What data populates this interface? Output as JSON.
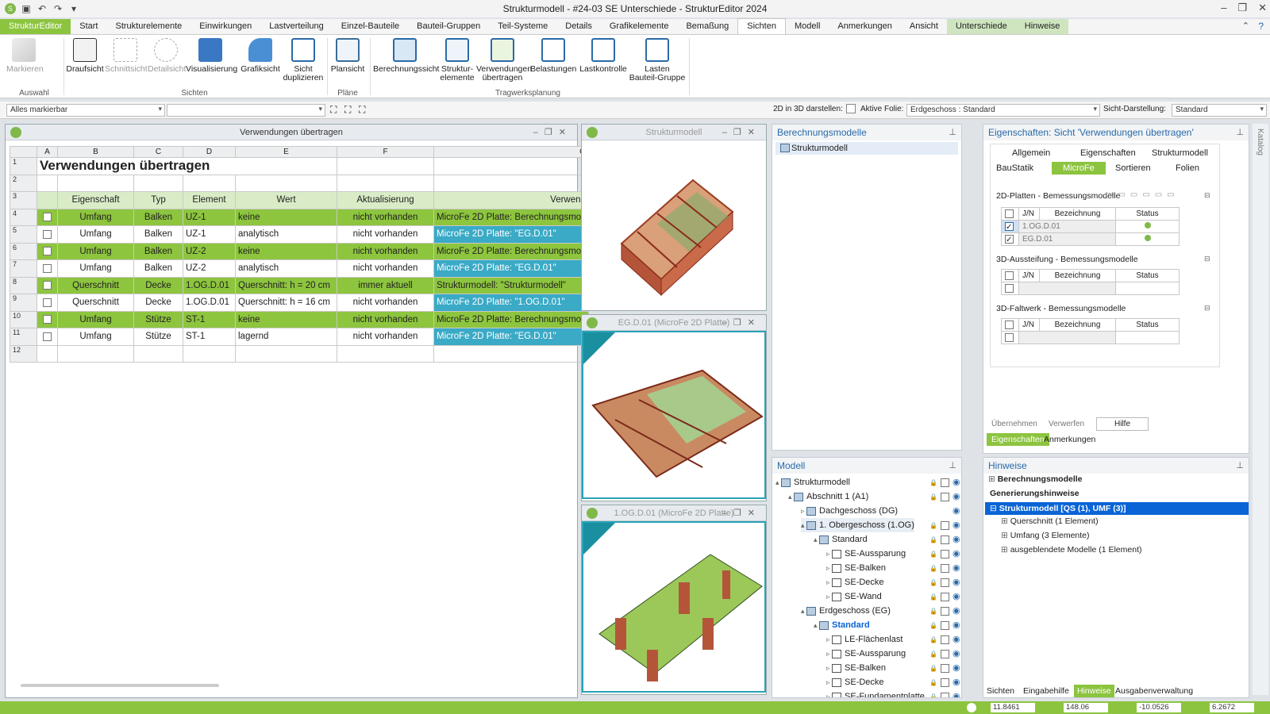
{
  "window": {
    "title": "Strukturmodell - #24-03 SE Unterschiede - StrukturEditor 2024"
  },
  "tabs": [
    "StrukturEditor",
    "Start",
    "Strukturelemente",
    "Einwirkungen",
    "Lastverteilung",
    "Einzel-Bauteile",
    "Bauteil-Gruppen",
    "Teil-Systeme",
    "Details",
    "Grafikelemente",
    "Bemaßung",
    "Sichten",
    "Modell",
    "Anmerkungen",
    "Ansicht",
    "Unterschiede",
    "Hinweise"
  ],
  "ribbon": {
    "markieren": "Markieren",
    "draufsicht": "Draufsicht",
    "schnittsicht": "Schnittsicht",
    "detailsicht": "Detailsicht",
    "visualisierung": "Visualisierung",
    "grafiksicht": "Grafiksicht",
    "sicht_dup_1": "Sicht",
    "sicht_dup_2": "duplizieren",
    "plansicht": "Plansicht",
    "berechnungssicht": "Berechnungssicht",
    "struktur_1": "Struktur-",
    "struktur_2": "elemente",
    "verw_1": "Verwendungen",
    "verw_2": "übertragen",
    "belastungen": "Belastungen",
    "lastkontrolle": "Lastkontrolle",
    "lasten_1": "Lasten",
    "lasten_2": "Bauteil-Gruppe",
    "grp_auswahl": "Auswahl",
    "grp_sichten": "Sichten",
    "grp_plaene": "Pläne",
    "grp_tragwerk": "Tragwerksplanung"
  },
  "toolbar": {
    "combo1": "Alles markierbar",
    "d2in3d": "2D in 3D darstellen:",
    "aktive_folie_label": "Aktive Folie:",
    "aktive_folie": "Erdgeschoss : Standard",
    "sicht_label": "Sicht-Darstellung:",
    "sicht_value": "Standard"
  },
  "table_panel": {
    "title": "Verwendungen übertragen",
    "columns": [
      "A",
      "B",
      "C",
      "D",
      "E",
      "F",
      "G"
    ],
    "heading": "Verwendungen übertragen",
    "headers": [
      "Eigenschaft",
      "Typ",
      "Element",
      "Wert",
      "Aktualisierung",
      "Verwend"
    ],
    "rows": [
      {
        "n": "4",
        "eig": "Umfang",
        "typ": "Balken",
        "el": "UZ-1",
        "wert": "keine",
        "akt": "nicht vorhanden",
        "verw": "MicroFe 2D Platte: Berechnungsmoc"
      },
      {
        "n": "5",
        "eig": "Umfang",
        "typ": "Balken",
        "el": "UZ-1",
        "wert": "analytisch",
        "akt": "nicht vorhanden",
        "verw": "MicroFe 2D Platte: \"EG.D.01\""
      },
      {
        "n": "6",
        "eig": "Umfang",
        "typ": "Balken",
        "el": "UZ-2",
        "wert": "keine",
        "akt": "nicht vorhanden",
        "verw": "MicroFe 2D Platte: Berechnungsmoc"
      },
      {
        "n": "7",
        "eig": "Umfang",
        "typ": "Balken",
        "el": "UZ-2",
        "wert": "analytisch",
        "akt": "nicht vorhanden",
        "verw": "MicroFe 2D Platte: \"EG.D.01\""
      },
      {
        "n": "8",
        "eig": "Querschnitt",
        "typ": "Decke",
        "el": "1.OG.D.01",
        "wert": "Querschnitt: h = 20 cm",
        "akt": "immer aktuell",
        "verw": "Strukturmodell: \"Strukturmodell\""
      },
      {
        "n": "9",
        "eig": "Querschnitt",
        "typ": "Decke",
        "el": "1.OG.D.01",
        "wert": "Querschnitt: h = 16 cm",
        "akt": "nicht vorhanden",
        "verw": "MicroFe 2D Platte: \"1.OG.D.01\""
      },
      {
        "n": "10",
        "eig": "Umfang",
        "typ": "Stütze",
        "el": "ST-1",
        "wert": "keine",
        "akt": "nicht vorhanden",
        "verw": "MicroFe 2D Platte: Berechnungsmoc"
      },
      {
        "n": "11",
        "eig": "Umfang",
        "typ": "Stütze",
        "el": "ST-1",
        "wert": "lagernd",
        "akt": "nicht vorhanden",
        "verw": "MicroFe 2D Platte: \"EG.D.01\""
      }
    ]
  },
  "views": {
    "v1": "Strukturmodell",
    "v2": "EG.D.01 (MicroFe 2D Platte)",
    "v3": "1.OG.D.01 (MicroFe 2D Platte)"
  },
  "berechnungsmodelle": {
    "title": "Berechnungsmodelle",
    "item": "Strukturmodell"
  },
  "modell": {
    "title": "Modell",
    "items": [
      "Strukturmodell",
      "Abschnitt 1 (A1)",
      "Dachgeschoss (DG)",
      "1. Obergeschoss (1.OG)",
      "Standard",
      "SE-Aussparung",
      "SE-Balken",
      "SE-Decke",
      "SE-Wand",
      "Erdgeschoss (EG)",
      "Standard",
      "LE-Flächenlast",
      "SE-Aussparung",
      "SE-Balken",
      "SE-Decke",
      "SE-Fundamentplatte"
    ]
  },
  "eigenschaften": {
    "title": "Eigenschaften: Sicht 'Verwendungen übertragen'",
    "tabs1": [
      "Allgemein",
      "Eigenschaften",
      "Strukturmodell"
    ],
    "tabs2": [
      "BauStatik",
      "MicroFe",
      "Sortieren",
      "Folien"
    ],
    "sec1": "2D-Platten - Bemessungsmodelle",
    "sec2": "3D-Aussteifung - Bemessungsmodelle",
    "sec3": "3D-Faltwerk - Bemessungsmodelle",
    "col_jn": "J/N",
    "col_bez": "Bezeichnung",
    "col_status": "Status",
    "rows": [
      "1.OG.D.01",
      "EG.D.01"
    ],
    "btn_ueber": "Übernehmen",
    "btn_verw": "Verwerfen",
    "btn_hilfe": "Hilfe",
    "bottom_tabs": [
      "Eigenschaften",
      "Anmerkungen"
    ]
  },
  "hinweise": {
    "title": "Hinweise",
    "items": [
      "Berechnungsmodelle",
      "Generierungshinweise",
      "Strukturmodell [QS (1), UMF (3)]",
      "Querschnitt (1 Element)",
      "Umfang (3 Elemente)",
      "ausgeblendete Modelle (1 Element)"
    ],
    "bottom_tabs": [
      "Sichten",
      "Eingabehilfe",
      "Hinweise",
      "Ausgabenverwaltung"
    ]
  },
  "statusbar": {
    "f1": "11.8461",
    "f2": "148.06",
    "f3": "-10.0526",
    "f4": "6.2672"
  },
  "side": {
    "katalog": "Katalog"
  },
  "colors": {
    "accent": "#8cc43f",
    "row_green": "#8dc53e",
    "highlight_blue": "#3aaac6",
    "selected": "#0a64d6"
  }
}
